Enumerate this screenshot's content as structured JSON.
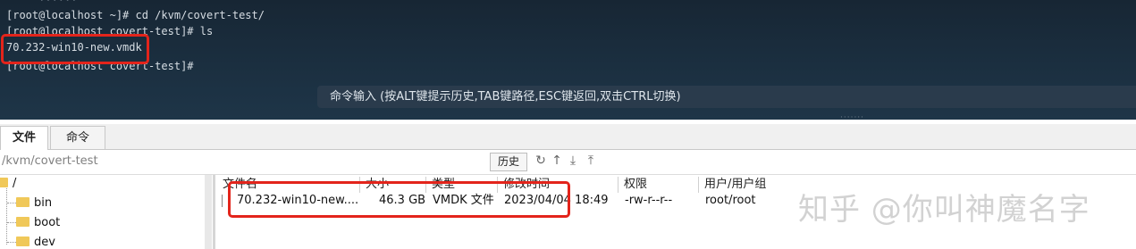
{
  "terminal": {
    "lines": [
      "[root@localhost ~]# cd /kvm/covert-test/",
      "[root@localhost covert-test]# ls",
      "70.232-win10-new.vmdk",
      "[root@localhost covert-test]#"
    ],
    "command_bar_hint": "命令输入 (按ALT键提示历史,TAB键路径,ESC键返回,双击CTRL切换)",
    "highlight_color": "#e3241b"
  },
  "tabs": [
    {
      "label": "文件",
      "active": true
    },
    {
      "label": "命令",
      "active": false
    }
  ],
  "pathbar": {
    "path": "/kvm/covert-test",
    "history_label": "历史",
    "icons": [
      "refresh-icon",
      "up-arrow-icon",
      "download-icon",
      "upload-icon"
    ]
  },
  "tree": {
    "root_label": "/",
    "items": [
      "bin",
      "boot",
      "dev"
    ]
  },
  "filelist": {
    "columns": [
      "文件名",
      "大小",
      "类型",
      "修改时间",
      "权限",
      "用户/用户组"
    ],
    "rows": [
      {
        "name": "70.232-win10-new....",
        "size": "46.3 GB",
        "type": "VMDK 文件",
        "modified": "2023/04/04 18:49",
        "permissions": "-rw-r--r--",
        "owner": "root/root"
      }
    ]
  },
  "watermark": "知乎 @你叫神魔名字"
}
